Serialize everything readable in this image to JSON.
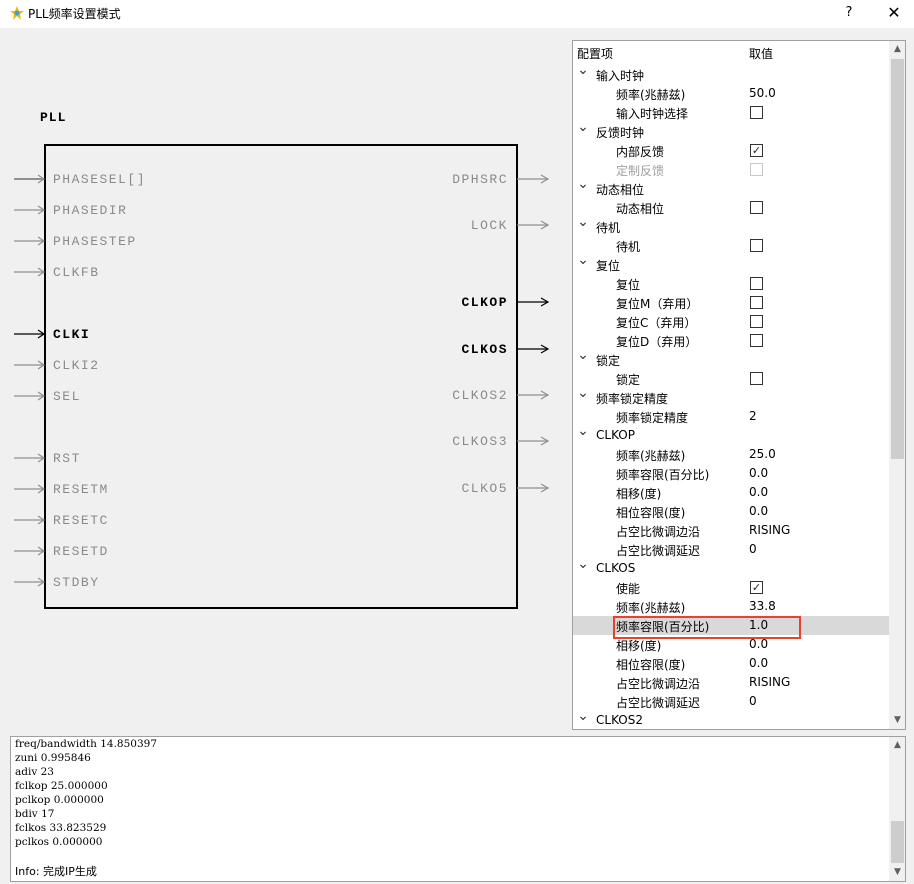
{
  "window": {
    "title": "PLL频率设置模式",
    "help": "?",
    "close": "✕"
  },
  "diagram": {
    "block_title": "PLL",
    "inputs": [
      {
        "label": "PHASESEL[]",
        "active": false
      },
      {
        "label": "PHASEDIR",
        "active": false
      },
      {
        "label": "PHASESTEP",
        "active": false
      },
      {
        "label": "CLKFB",
        "active": false
      },
      {
        "label": "CLKI",
        "active": true
      },
      {
        "label": "CLKI2",
        "active": false
      },
      {
        "label": "SEL",
        "active": false
      },
      {
        "label": "RST",
        "active": false
      },
      {
        "label": "RESETM",
        "active": false
      },
      {
        "label": "RESETC",
        "active": false
      },
      {
        "label": "RESETD",
        "active": false
      },
      {
        "label": "STDBY",
        "active": false
      }
    ],
    "outputs": [
      {
        "label": "DPHSRC",
        "active": false
      },
      {
        "label": "LOCK",
        "active": false
      },
      {
        "label": "CLKOP",
        "active": true
      },
      {
        "label": "CLKOS",
        "active": true
      },
      {
        "label": "CLKOS2",
        "active": false
      },
      {
        "label": "CLKOS3",
        "active": false
      },
      {
        "label": "CLKO5",
        "active": false
      }
    ]
  },
  "props": {
    "header": {
      "name": "配置项",
      "value": "取值"
    },
    "rows": [
      {
        "level": 0,
        "label": "输入时钟"
      },
      {
        "level": 1,
        "label": "频率(兆赫兹)",
        "value": "50.0"
      },
      {
        "level": 1,
        "label": "输入时钟选择",
        "checkbox": false
      },
      {
        "level": 0,
        "label": "反馈时钟"
      },
      {
        "level": 1,
        "label": "内部反馈",
        "checkbox": true
      },
      {
        "level": 1,
        "label": "定制反馈",
        "checkbox": false,
        "disabled": true
      },
      {
        "level": 0,
        "label": "动态相位"
      },
      {
        "level": 1,
        "label": "动态相位",
        "checkbox": false
      },
      {
        "level": 0,
        "label": "待机"
      },
      {
        "level": 1,
        "label": "待机",
        "checkbox": false
      },
      {
        "level": 0,
        "label": "复位"
      },
      {
        "level": 1,
        "label": "复位",
        "checkbox": false
      },
      {
        "level": 1,
        "label": "复位M（弃用）",
        "checkbox": false
      },
      {
        "level": 1,
        "label": "复位C（弃用）",
        "checkbox": false
      },
      {
        "level": 1,
        "label": "复位D（弃用）",
        "checkbox": false
      },
      {
        "level": 0,
        "label": "锁定"
      },
      {
        "level": 1,
        "label": "锁定",
        "checkbox": false
      },
      {
        "level": 0,
        "label": "频率锁定精度"
      },
      {
        "level": 1,
        "label": "频率锁定精度",
        "value": "2"
      },
      {
        "level": 0,
        "label": "CLKOP"
      },
      {
        "level": 1,
        "label": "频率(兆赫兹)",
        "value": "25.0"
      },
      {
        "level": 1,
        "label": "频率容限(百分比)",
        "value": "0.0"
      },
      {
        "level": 1,
        "label": "相移(度)",
        "value": "0.0"
      },
      {
        "level": 1,
        "label": "相位容限(度)",
        "value": "0.0"
      },
      {
        "level": 1,
        "label": "占空比微调边沿",
        "value": "RISING"
      },
      {
        "level": 1,
        "label": "占空比微调延迟",
        "value": "0"
      },
      {
        "level": 0,
        "label": "CLKOS"
      },
      {
        "level": 1,
        "label": "使能",
        "checkbox": true
      },
      {
        "level": 1,
        "label": "频率(兆赫兹)",
        "value": "33.8"
      },
      {
        "level": 1,
        "label": "频率容限(百分比)",
        "value": "1.0",
        "selected": true
      },
      {
        "level": 1,
        "label": "相移(度)",
        "value": "0.0"
      },
      {
        "level": 1,
        "label": "相位容限(度)",
        "value": "0.0"
      },
      {
        "level": 1,
        "label": "占空比微调边沿",
        "value": "RISING"
      },
      {
        "level": 1,
        "label": "占空比微调延迟",
        "value": "0"
      },
      {
        "level": 0,
        "label": "CLKOS2"
      }
    ]
  },
  "log": {
    "lines": [
      "freq/bandwidth 14.850397",
      "zuni 0.995846",
      "adiv 23",
      "fclkop 25.000000",
      "pclkop 0.000000",
      "bdiv 17",
      "fclkos 33.823529",
      "pclkos 0.000000",
      "",
      "Info: 完成IP生成"
    ]
  },
  "colors": {
    "highlight_border": "#e8412c",
    "inactive_pin": "#909090",
    "active_pin": "#000000"
  }
}
